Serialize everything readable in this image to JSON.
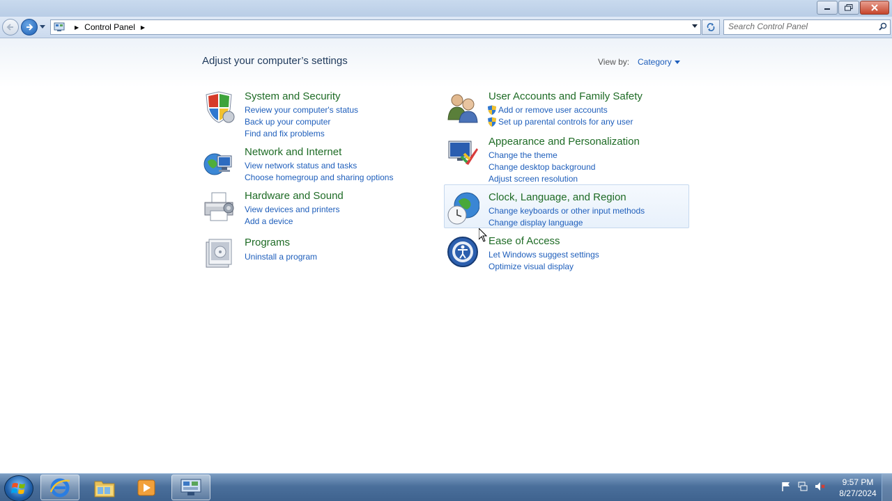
{
  "window": {
    "controls": {
      "minimize": "minimize-icon",
      "maximize": "restore-icon",
      "close": "close-icon"
    }
  },
  "address_bar": {
    "path": [
      "Control Panel"
    ],
    "search_placeholder": "Search Control Panel"
  },
  "content": {
    "heading": "Adjust your computer’s settings",
    "view_by_label": "View by:",
    "view_by_value": "Category",
    "categories": [
      {
        "title": "System and Security",
        "icon": "shield-icon",
        "links": [
          "Review your computer's status",
          "Back up your computer",
          "Find and fix problems"
        ]
      },
      {
        "title": "Network and Internet",
        "icon": "network-globe-icon",
        "links": [
          "View network status and tasks",
          "Choose homegroup and sharing options"
        ]
      },
      {
        "title": "Hardware and Sound",
        "icon": "printer-icon",
        "links": [
          "View devices and printers",
          "Add a device"
        ]
      },
      {
        "title": "Programs",
        "icon": "programs-icon",
        "links": [
          "Uninstall a program"
        ]
      },
      {
        "title": "User Accounts and Family Safety",
        "icon": "users-icon",
        "links": [
          "Add or remove user accounts",
          "Set up parental controls for any user"
        ]
      },
      {
        "title": "Appearance and Personalization",
        "icon": "monitor-paint-icon",
        "links": [
          "Change the theme",
          "Change desktop background",
          "Adjust screen resolution"
        ]
      },
      {
        "title": "Clock, Language, and Region",
        "icon": "globe-clock-icon",
        "links": [
          "Change keyboards or other input methods",
          "Change display language"
        ]
      },
      {
        "title": "Ease of Access",
        "icon": "ease-of-access-icon",
        "links": [
          "Let Windows suggest settings",
          "Optimize visual display"
        ]
      }
    ]
  },
  "taskbar": {
    "pinned": [
      "internet-explorer-icon",
      "file-explorer-icon",
      "media-player-icon",
      "control-panel-icon"
    ],
    "active": "control-panel-icon",
    "clock_time": "9:57 PM",
    "clock_date": "8/27/2024"
  },
  "colors": {
    "category_title": "#1e6b25",
    "link": "#1e5ebb",
    "heading": "#1e395b"
  }
}
